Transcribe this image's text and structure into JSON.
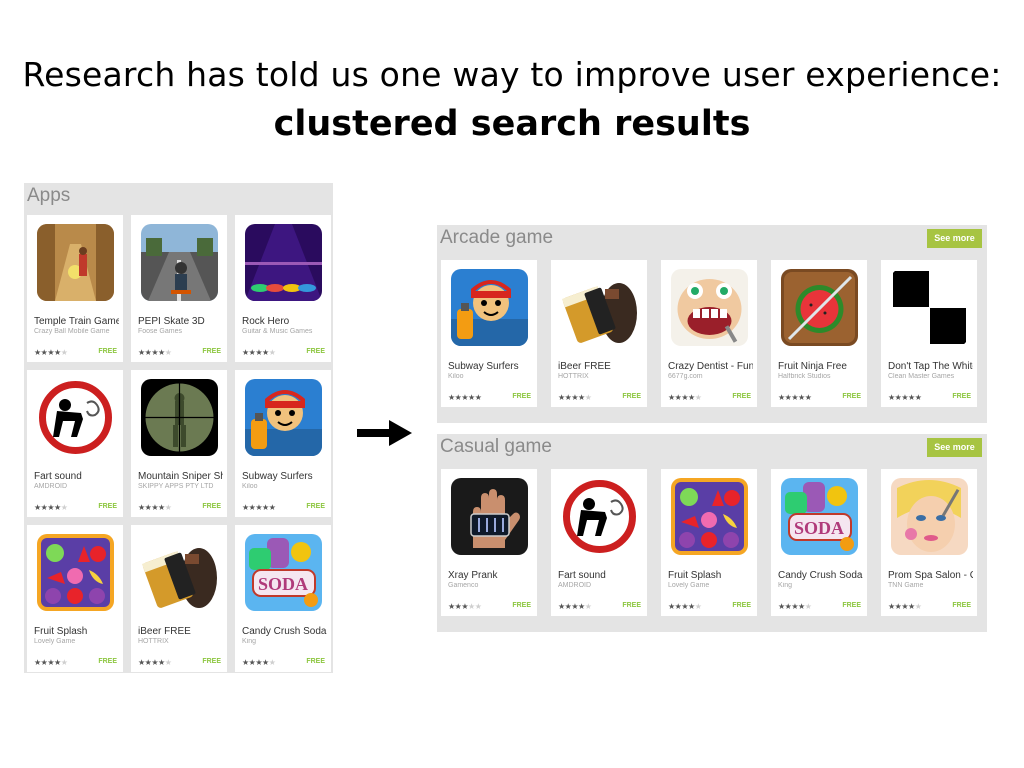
{
  "title": {
    "line1": "Research has told us one way to improve user experience:",
    "line2": "clustered search results"
  },
  "colors": {
    "panel_bg": "#e4e4e4",
    "price_green": "#8cc63f",
    "see_more_green": "#a7c442"
  },
  "left_panel": {
    "title": "Apps",
    "apps": [
      {
        "name": "Temple Train Game",
        "developer": "Crazy Ball Mobile Game",
        "rating": 3.5,
        "price": "FREE",
        "icon": "temple-run-icon"
      },
      {
        "name": "PEPI Skate 3D",
        "developer": "Foose Games",
        "rating": 3.5,
        "price": "FREE",
        "icon": "skate-icon"
      },
      {
        "name": "Rock Hero",
        "developer": "Guitar & Music Games",
        "rating": 3.5,
        "price": "FREE",
        "icon": "guitar-hero-icon"
      },
      {
        "name": "Fart sound",
        "developer": "AMDROID",
        "rating": 3.5,
        "price": "FREE",
        "icon": "fart-sign-icon"
      },
      {
        "name": "Mountain Sniper Sh",
        "developer": "SKIPPY APPS PTY LTD",
        "rating": 3.5,
        "price": "FREE",
        "icon": "sniper-scope-icon"
      },
      {
        "name": "Subway Surfers",
        "developer": "Kiloo",
        "rating": 4.5,
        "price": "FREE",
        "icon": "subway-surfers-icon"
      },
      {
        "name": "Fruit Splash",
        "developer": "Lovely Game",
        "rating": 4,
        "price": "FREE",
        "icon": "fruit-splash-icon"
      },
      {
        "name": "iBeer FREE",
        "developer": "HOTTRIX",
        "rating": 4,
        "price": "FREE",
        "icon": "ibeer-icon"
      },
      {
        "name": "Candy Crush Soda",
        "developer": "King",
        "rating": 4,
        "price": "FREE",
        "icon": "candy-soda-icon"
      }
    ]
  },
  "clusters": [
    {
      "title": "Arcade game",
      "see_more": "See more",
      "apps": [
        {
          "name": "Subway Surfers",
          "developer": "Kiloo",
          "rating": 4.5,
          "price": "FREE",
          "icon": "subway-surfers-icon"
        },
        {
          "name": "iBeer FREE",
          "developer": "HOTTRIX",
          "rating": 4,
          "price": "FREE",
          "icon": "ibeer-icon"
        },
        {
          "name": "Crazy Dentist - Fun",
          "developer": "6677g.com",
          "rating": 4,
          "price": "FREE",
          "icon": "dentist-icon"
        },
        {
          "name": "Fruit Ninja Free",
          "developer": "Halfbrick Studios",
          "rating": 4.5,
          "price": "FREE",
          "icon": "fruit-ninja-icon"
        },
        {
          "name": "Don't Tap The White",
          "developer": "Clean Master Games",
          "rating": 4.5,
          "price": "FREE",
          "icon": "piano-tiles-icon"
        }
      ]
    },
    {
      "title": "Casual game",
      "see_more": "See more",
      "apps": [
        {
          "name": "Xray Prank",
          "developer": "Gamenco",
          "rating": 3,
          "price": "FREE",
          "icon": "xray-hand-icon"
        },
        {
          "name": "Fart sound",
          "developer": "AMDROID",
          "rating": 3.5,
          "price": "FREE",
          "icon": "fart-sign-icon"
        },
        {
          "name": "Fruit Splash",
          "developer": "Lovely Game",
          "rating": 4,
          "price": "FREE",
          "icon": "fruit-splash-icon"
        },
        {
          "name": "Candy Crush Soda",
          "developer": "King",
          "rating": 4,
          "price": "FREE",
          "icon": "candy-soda-icon"
        },
        {
          "name": "Prom Spa Salon - G",
          "developer": "TNN Game",
          "rating": 3.5,
          "price": "FREE",
          "icon": "spa-salon-icon"
        }
      ]
    }
  ],
  "arrow_icon": "right-arrow-icon"
}
